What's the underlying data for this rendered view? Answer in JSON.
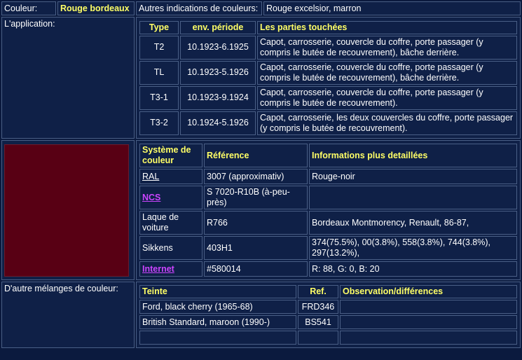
{
  "header": {
    "couleur_label": "Couleur:",
    "couleur_value": "Rouge bordeaux",
    "autres_label": "Autres indications de couleurs:",
    "autres_value": "Rouge excelsior, marron"
  },
  "application": {
    "label": "L'application:",
    "columns": [
      "Type",
      "env. période",
      "Les parties touchées"
    ],
    "rows": [
      {
        "type": "T2",
        "periode": "10.1923-6.1925",
        "parties": "Capot, carrosserie, couvercle du coffre, porte passager (y compris le butée de recouvrement), bâche derrière."
      },
      {
        "type": "TL",
        "periode": "10.1923-5.1926",
        "parties": "Capot, carrosserie, couvercle du coffre, porte passager (y compris le butée de recouvrement), bâche derrière."
      },
      {
        "type": "T3-1",
        "periode": "10.1923-9.1924",
        "parties": "Capot, carrosserie, couvercle du coffre, porte passager (y compris le butée de recouvrement)."
      },
      {
        "type": "T3-2",
        "periode": "10.1924-5.1926",
        "parties": "Capot, carrosserie, les deux couvercles du coffre, porte passager (y compris le butée de recouvrement)."
      }
    ]
  },
  "swatch_color": "#580014",
  "systems": {
    "columns": [
      "Système de couleur",
      "Référence",
      "Informations plus detaillées"
    ],
    "rows": [
      {
        "system": "RAL",
        "ref": "3007 (approximativ)",
        "info": "Rouge-noir"
      },
      {
        "system": "NCS",
        "ref": "S 7020-R10B (à-peu-près)",
        "info": ""
      },
      {
        "system": "Laque de voiture",
        "ref": "R766",
        "info": "Bordeaux Montmorency, Renault, 86-87,"
      },
      {
        "system": "Sikkens",
        "ref": "403H1",
        "info": "374(75.5%), 00(3.8%), 558(3.8%), 744(3.8%), 297(13.2%),"
      },
      {
        "system": "Internet",
        "ref": "#580014",
        "info": "R: 88, G: 0, B: 20"
      }
    ]
  },
  "melanges": {
    "label": "D'autre mélanges de couleur:",
    "columns": [
      "Teinte",
      "Ref.",
      "Observation/différences"
    ],
    "rows": [
      {
        "teinte": "Ford, black cherry (1965-68)",
        "ref": "FRD346",
        "obs": ""
      },
      {
        "teinte": "British Standard, maroon (1990-)",
        "ref": "BS541",
        "obs": ""
      },
      {
        "teinte": "",
        "ref": "",
        "obs": ""
      }
    ]
  }
}
